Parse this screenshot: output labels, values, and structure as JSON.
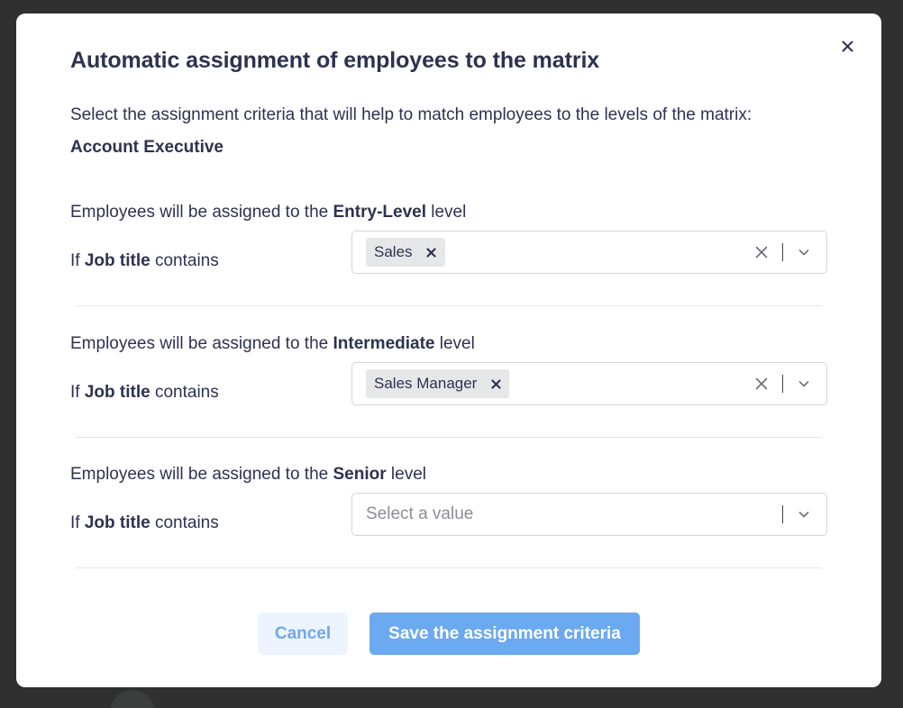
{
  "modal": {
    "title": "Automatic assignment of employees to the matrix",
    "intro": "Select the assignment criteria that will help to match employees to the levels of the matrix:",
    "matrix_name": "Account Executive",
    "heading_prefix": "Employees will be assigned to the ",
    "heading_suffix": " level",
    "condition_prefix": "If ",
    "condition_field": "Job title",
    "condition_suffix": " contains",
    "sections": [
      {
        "level": "Entry-Level",
        "selected": [
          "Sales"
        ]
      },
      {
        "level": "Intermediate",
        "selected": [
          "Sales Manager"
        ]
      },
      {
        "level": "Senior",
        "selected": [],
        "placeholder": "Select a value"
      }
    ],
    "cancel_label": "Cancel",
    "save_label": "Save the assignment criteria"
  },
  "colors": {
    "overlay": "#2f302f",
    "text": "#2e3250",
    "primary": "#6ba9f0",
    "cancel_bg": "#eef4fd",
    "chip_bg": "#e6e7e8"
  },
  "icons": {
    "close": "close-icon",
    "chip_remove": "close-icon",
    "clear": "clear-icon",
    "dropdown": "chevron-down-icon"
  }
}
